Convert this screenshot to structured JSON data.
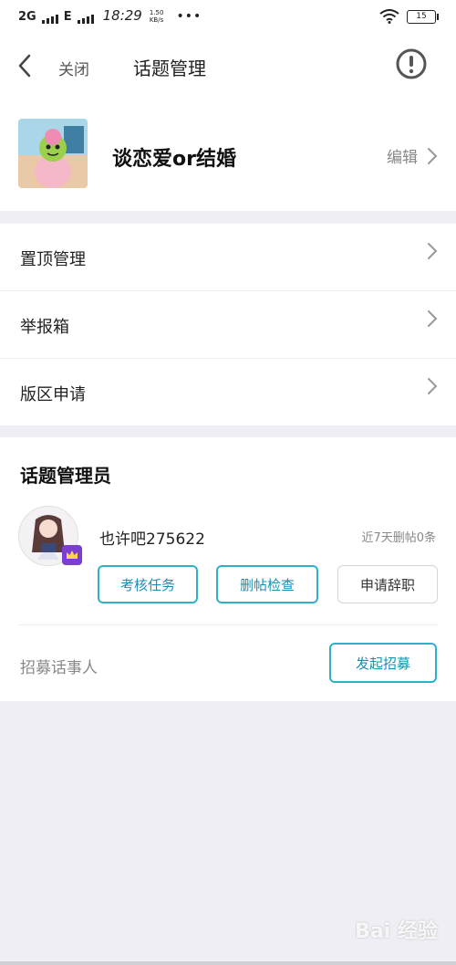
{
  "status": {
    "network": "2G",
    "network2": "E",
    "time": "18:29",
    "speed_value": "1.50",
    "speed_unit": "KB/s",
    "dots": "•••",
    "battery": "15"
  },
  "nav": {
    "close_label": "关闭",
    "title": "话题管理"
  },
  "topic": {
    "name": "谈恋爱or结婚",
    "edit_label": "编辑"
  },
  "menu": [
    {
      "label": "置顶管理"
    },
    {
      "label": "举报箱"
    },
    {
      "label": "版区申请"
    }
  ],
  "admin": {
    "title": "话题管理员",
    "username": "也许吧275622",
    "stat": "近7天删帖0条",
    "buttons": {
      "assess": "考核任务",
      "delete_check": "删帖检查",
      "resign": "申请辞职"
    },
    "recruit_label": "招募话事人",
    "recruit_button": "发起招募"
  },
  "watermark": "Bai 经验",
  "colors": {
    "accent": "#2fb0c9",
    "background": "#eeeef4",
    "crown": "#7b3fd0"
  }
}
